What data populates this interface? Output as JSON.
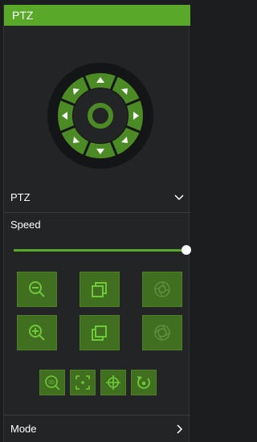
{
  "header": {
    "title": "PTZ"
  },
  "ptz_row": {
    "label": "PTZ"
  },
  "speed": {
    "label": "Speed",
    "level": 1.0
  },
  "mode_row": {
    "label": "Mode"
  },
  "colors": {
    "accent": "#5aa82a",
    "button": "#3f6f1f",
    "bg": "#222426"
  },
  "icons": {
    "zoom_out": "zoom-out-icon",
    "zoom_in": "zoom-in-icon",
    "focus_near": "focus-window-icon",
    "focus_far": "focus-window-alt-icon",
    "iris_open": "iris-icon",
    "iris_close": "iris-alt-icon",
    "zoom3d": "3d-zoom-icon",
    "fit": "fit-frame-icon",
    "center": "center-target-icon",
    "reset": "reset-icon"
  }
}
